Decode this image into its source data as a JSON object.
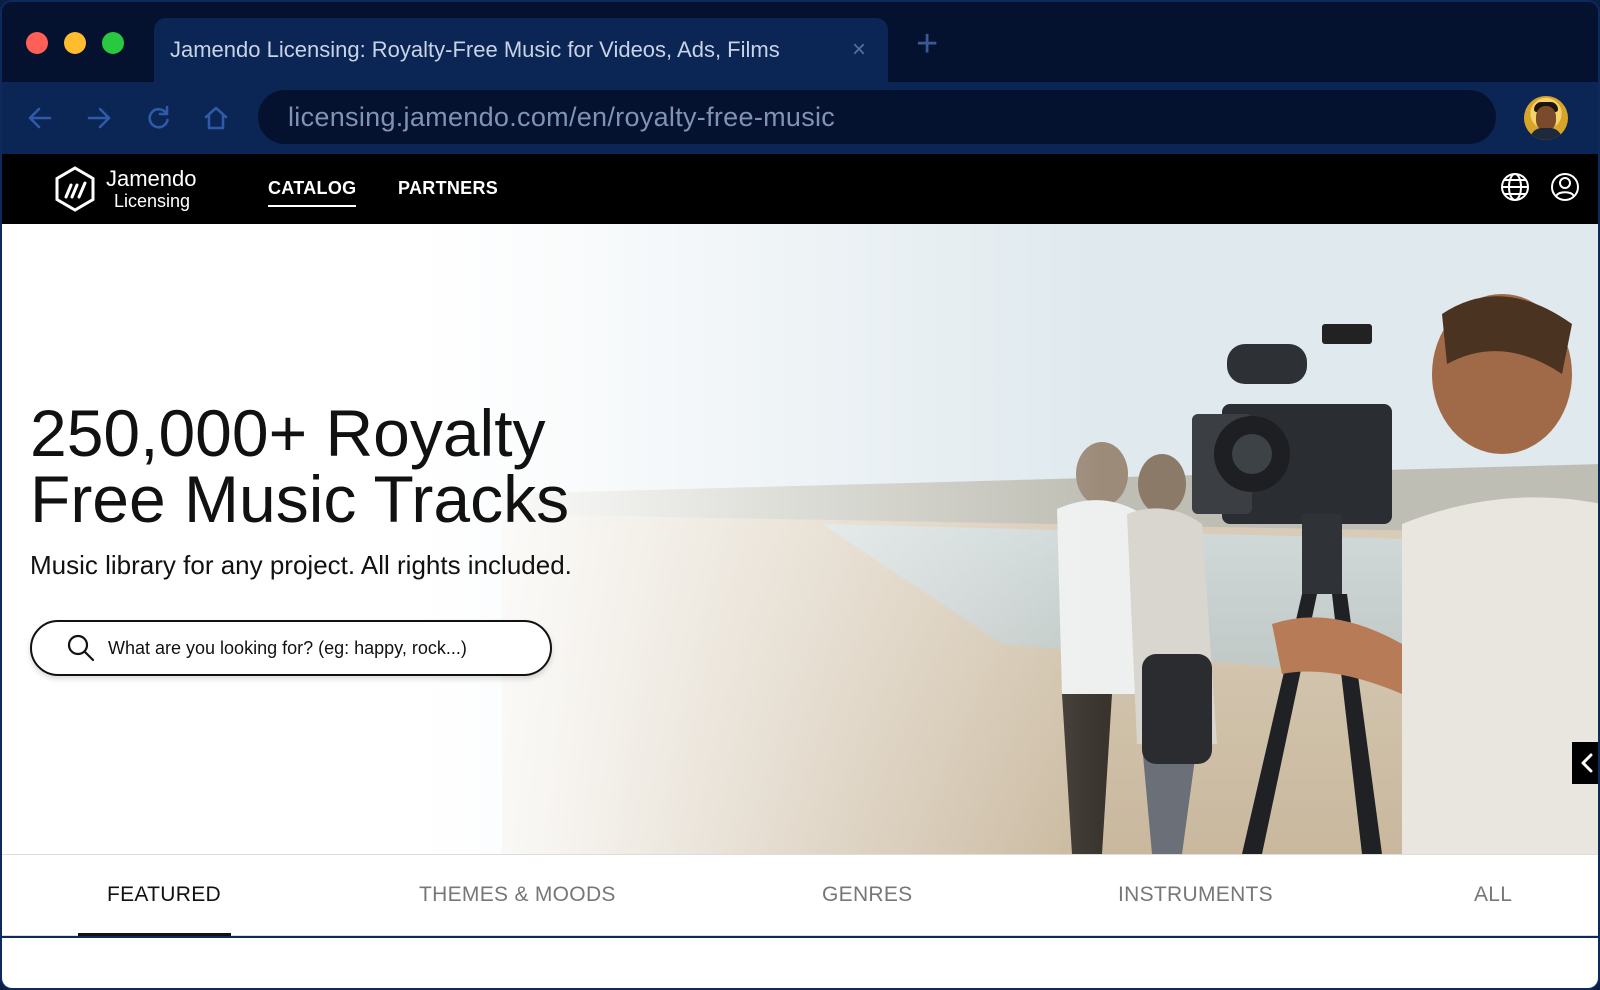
{
  "browser": {
    "tab_title": "Jamendo Licensing: Royalty-Free Music for Videos, Ads, Films",
    "tab_close": "×",
    "new_tab": "+",
    "url": "licensing.jamendo.com/en/royalty-free-music"
  },
  "header": {
    "logo_line1": "Jamendo",
    "logo_line2": "Licensing",
    "menu": [
      {
        "label": "CATALOG"
      },
      {
        "label": "PARTNERS"
      }
    ]
  },
  "hero": {
    "title_line1": "250,000+ Royalty",
    "title_line2": "Free Music Tracks",
    "subtitle": "Music library for any project. All rights included.",
    "search_placeholder": "What are you looking for? (eg: happy, rock...)"
  },
  "category_tabs": [
    {
      "label": "FEATURED",
      "active": true
    },
    {
      "label": "THEMES & MOODS",
      "active": false
    },
    {
      "label": "GENRES",
      "active": false
    },
    {
      "label": "INSTRUMENTS",
      "active": false
    },
    {
      "label": "ALL",
      "active": false
    }
  ],
  "colors": {
    "browser_chrome": "#041230",
    "site_header": "#000000",
    "accent_underline": "#111111"
  }
}
